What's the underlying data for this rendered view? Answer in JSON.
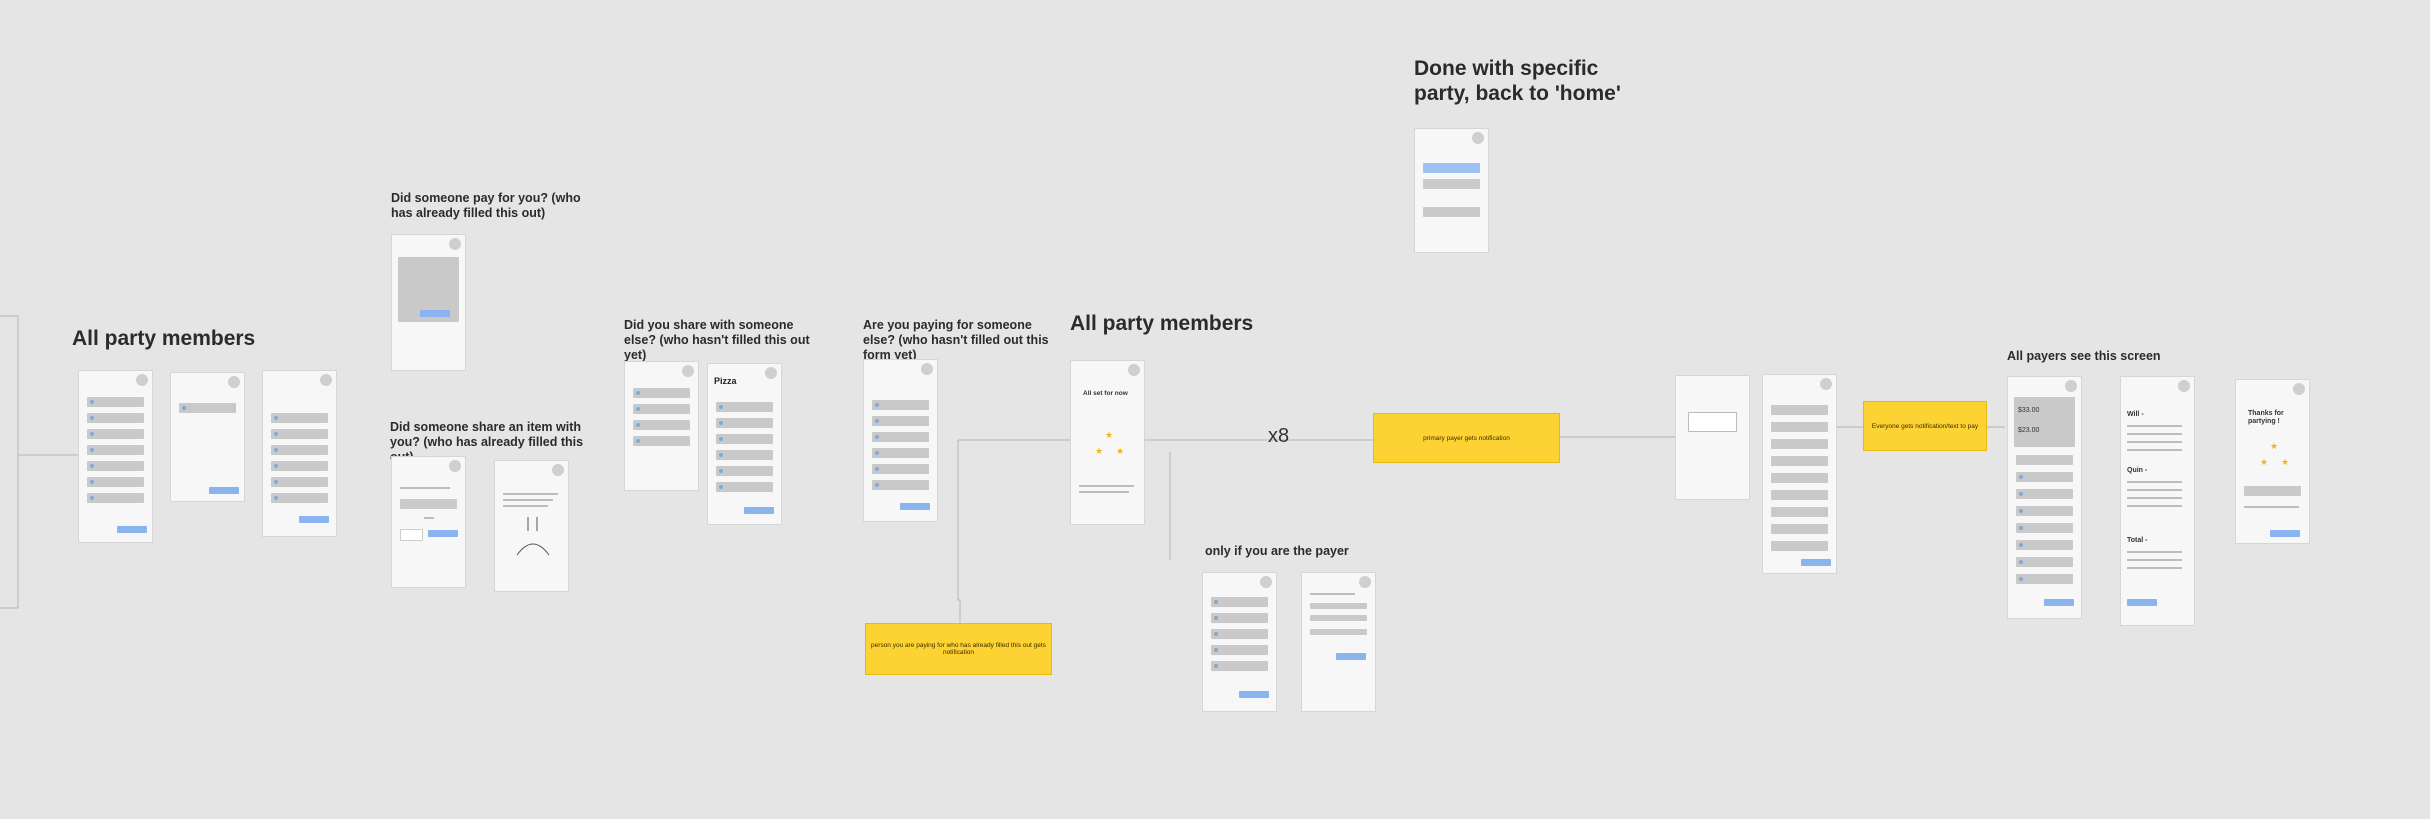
{
  "headings": {
    "all_party_members_1": "All party members",
    "did_someone_pay": "Did someone pay for you? (who has already filled this out)",
    "did_someone_share": "Did someone share an item with you? (who has already filled this out)",
    "did_you_share": "Did you share with someone else? (who hasn't filled this out yet)",
    "are_you_paying": "Are you paying for someone else? (who hasn't filled out this form yet)",
    "all_party_members_2": "All party members",
    "done_with_party": "Done with specific party, back to 'home'",
    "only_if_payer": "only if you are the payer",
    "all_payers": "All payers see this screen"
  },
  "multiplier": "x8",
  "stickies": {
    "primary_payer": "primary payer gets notification",
    "everyone_gets": "Everyone gets notification/text to pay",
    "person_paying": "person you are paying for who has already filled this out gets notification"
  },
  "screens": {
    "all_set_title": "All set for now",
    "pizza_title": "Pizza",
    "thanks_title": "Thanks for partying !",
    "amount_1": "$33.00",
    "amount_2": "$23.00",
    "will_label": "Will -",
    "quin_label": "Quin -",
    "total_label": "Total -"
  },
  "colors": {
    "canvas": "#e5e5e5",
    "sticky": "#fdd233",
    "button": "#8ab4f0",
    "star": "#f2b418"
  }
}
